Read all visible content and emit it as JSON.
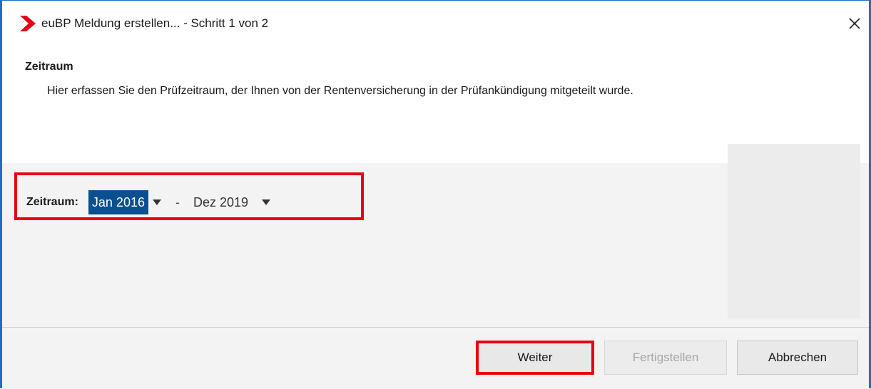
{
  "window": {
    "title": "euBP Meldung erstellen... - Schritt 1 von 2",
    "logo_icon": "red-chevron-logo",
    "close_icon": "close-icon",
    "accent_color": "#1c6fc4"
  },
  "header": {
    "section_title": "Zeitraum",
    "description": "Hier erfassen Sie den Prüfzeitraum, der Ihnen von der Rentenversicherung in der Prüfankündigung mitgeteilt wurde."
  },
  "period": {
    "label": "Zeitraum:",
    "from_value": "Jan 2016",
    "separator": "-",
    "to_value": "Dez 2019"
  },
  "buttons": {
    "next": "Weiter",
    "finish": "Fertigstellen",
    "cancel": "Abbrechen"
  },
  "highlight_color": "#e8000d"
}
